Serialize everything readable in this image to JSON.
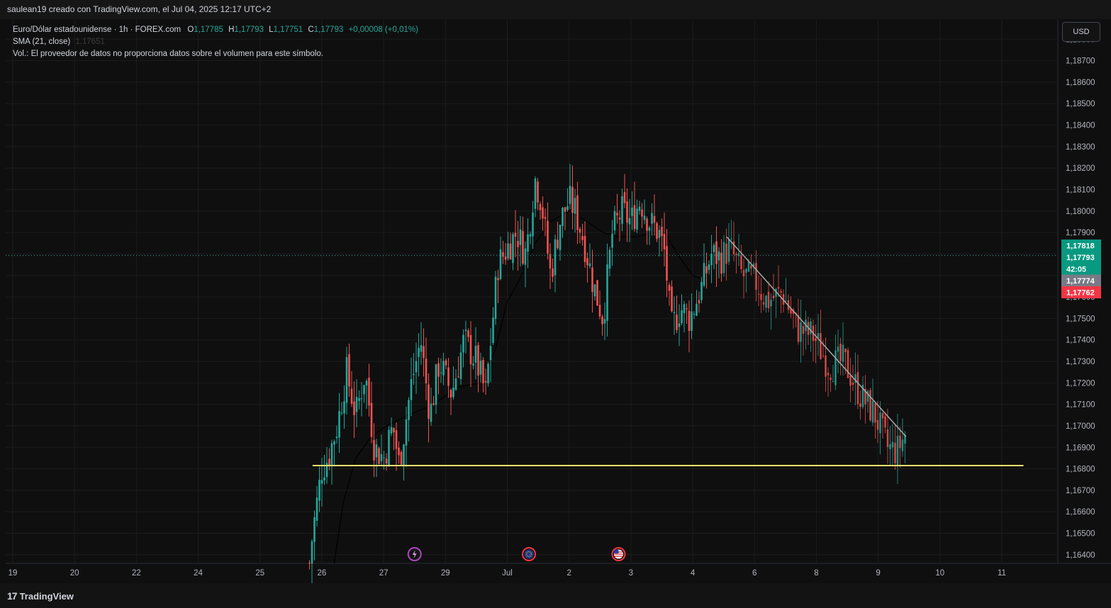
{
  "header": {
    "attribution": "saulean19 creado con TradingView.com, el Jul 04, 2025 12:17 UTC+2"
  },
  "legend": {
    "symbol": "Euro/Dólar estadounidense · 1h · FOREX.com",
    "o_label": "O",
    "o": "1,17785",
    "h_label": "H",
    "h": "1,17793",
    "l_label": "L",
    "l": "1,17751",
    "c_label": "C",
    "c": "1,17793",
    "change": "+0,00008 (+0,01%)",
    "sma_label": "SMA (21, close)",
    "sma_value": "1,17651",
    "vol_note": "Vol.: El proveedor de datos no proporciona datos sobre el volumen para este símbolo."
  },
  "currency_button": "USD",
  "footer": {
    "brand": "TradingView",
    "brand_mark": "17"
  },
  "colors": {
    "up": "#26a69a",
    "down": "#ef5350",
    "support": "#f5e26b",
    "sma": "#000000",
    "trend": "#a9a9a9"
  },
  "price_badges": [
    {
      "value": "1,17818",
      "color": "#089981"
    },
    {
      "value": "1,17793",
      "color": "#089981"
    },
    {
      "value": "42:05",
      "color": "#089981"
    },
    {
      "value": "1,17774",
      "color": "#787b86"
    },
    {
      "value": "1,17762",
      "color": "#f23645"
    }
  ],
  "event_markers": [
    {
      "icon": "lightning-icon",
      "x": 6.5
    },
    {
      "icon": "eu-flag-icon",
      "x": 8.35
    },
    {
      "icon": "us-flag-icon",
      "x": 9.8
    }
  ],
  "chart_data": {
    "type": "candlestick",
    "symbol": "EURUSD",
    "interval": "1h",
    "x_axis": {
      "range": [
        0,
        11.5
      ],
      "ticks": [
        {
          "x": 0,
          "label": "19"
        },
        {
          "x": 1,
          "label": "20"
        },
        {
          "x": 2,
          "label": "22"
        },
        {
          "x": 3,
          "label": "24"
        },
        {
          "x": 4,
          "label": "25"
        },
        {
          "x": 5,
          "label": "26"
        },
        {
          "x": 6,
          "label": "27"
        },
        {
          "x": 7,
          "label": "29"
        },
        {
          "x": 8,
          "label": "Jul"
        },
        {
          "x": 9,
          "label": "2"
        },
        {
          "x": 10,
          "label": "3"
        },
        {
          "x": 11,
          "label": "4"
        },
        {
          "x": 12,
          "label": "6"
        },
        {
          "x": 13,
          "label": "8"
        },
        {
          "x": 14,
          "label": "9"
        },
        {
          "x": 15,
          "label": "10"
        },
        {
          "x": 16,
          "label": "11"
        }
      ]
    },
    "y_axis": {
      "range": [
        1.1636,
        1.1889
      ],
      "ticks": [
        "1,16400",
        "1,16500",
        "1,16600",
        "1,16700",
        "1,16800",
        "1,16900",
        "1,17000",
        "1,17100",
        "1,17200",
        "1,17300",
        "1,17400",
        "1,17500",
        "1,17600",
        "1,17700",
        "1,17800",
        "1,17900",
        "1,18000",
        "1,18100",
        "1,18200",
        "1,18300",
        "1,18400",
        "1,18500",
        "1,18600",
        "1,18700",
        "1,18800"
      ]
    },
    "grid": true,
    "current_price": 1.17793,
    "support_line": {
      "price": 1.16815,
      "x_start": 4.85,
      "x_end": 16.35
    },
    "trend_line": {
      "x1": 11.55,
      "y1": 1.1788,
      "x2": 14.45,
      "y2": 1.1695
    },
    "anchors": [
      [
        4.8,
        1.1636
      ],
      [
        4.85,
        1.165
      ],
      [
        4.9,
        1.166
      ],
      [
        5.0,
        1.168
      ],
      [
        5.1,
        1.1685
      ],
      [
        5.25,
        1.17
      ],
      [
        5.4,
        1.1725
      ],
      [
        5.55,
        1.1705
      ],
      [
        5.7,
        1.1725
      ],
      [
        5.85,
        1.169
      ],
      [
        6.0,
        1.1685
      ],
      [
        6.15,
        1.17
      ],
      [
        6.25,
        1.1682
      ],
      [
        6.45,
        1.172
      ],
      [
        6.6,
        1.174
      ],
      [
        6.75,
        1.1705
      ],
      [
        6.9,
        1.173
      ],
      [
        7.1,
        1.1715
      ],
      [
        7.3,
        1.174
      ],
      [
        7.5,
        1.173
      ],
      [
        7.65,
        1.1715
      ],
      [
        7.75,
        1.1745
      ],
      [
        7.85,
        1.1775
      ],
      [
        8.0,
        1.1783
      ],
      [
        8.15,
        1.179
      ],
      [
        8.3,
        1.178
      ],
      [
        8.45,
        1.1815
      ],
      [
        8.55,
        1.1805
      ],
      [
        8.7,
        1.177
      ],
      [
        8.85,
        1.1795
      ],
      [
        9.0,
        1.1805
      ],
      [
        9.1,
        1.18
      ],
      [
        9.25,
        1.1785
      ],
      [
        9.4,
        1.1765
      ],
      [
        9.55,
        1.175
      ],
      [
        9.7,
        1.179
      ],
      [
        9.85,
        1.18
      ],
      [
        10.0,
        1.1795
      ],
      [
        10.15,
        1.1805
      ],
      [
        10.3,
        1.1795
      ],
      [
        10.45,
        1.179
      ],
      [
        10.55,
        1.178
      ],
      [
        10.65,
        1.1745
      ],
      [
        10.8,
        1.1755
      ],
      [
        10.95,
        1.175
      ],
      [
        11.15,
        1.1765
      ],
      [
        11.3,
        1.178
      ],
      [
        11.45,
        1.1778
      ],
      [
        11.6,
        1.1783
      ],
      [
        11.8,
        1.177
      ],
      [
        12.0,
        1.1768
      ],
      [
        12.2,
        1.1758
      ],
      [
        12.45,
        1.1762
      ],
      [
        12.7,
        1.1745
      ],
      [
        12.95,
        1.1742
      ],
      [
        13.2,
        1.1728
      ],
      [
        13.45,
        1.173
      ],
      [
        13.7,
        1.1715
      ],
      [
        13.95,
        1.1705
      ],
      [
        14.15,
        1.169
      ],
      [
        14.3,
        1.1688
      ],
      [
        14.45,
        1.1697
      ]
    ],
    "sma": [
      [
        5.2,
        1.1636
      ],
      [
        5.35,
        1.1665
      ],
      [
        5.55,
        1.1685
      ],
      [
        5.8,
        1.1695
      ],
      [
        6.05,
        1.17
      ],
      [
        6.4,
        1.1705
      ],
      [
        6.8,
        1.171
      ],
      [
        7.2,
        1.1718
      ],
      [
        7.55,
        1.172
      ],
      [
        7.8,
        1.1735
      ],
      [
        8.0,
        1.1758
      ],
      [
        8.2,
        1.1768
      ],
      [
        8.45,
        1.1785
      ],
      [
        8.7,
        1.1795
      ],
      [
        9.0,
        1.18
      ],
      [
        9.3,
        1.1795
      ],
      [
        9.55,
        1.179
      ],
      [
        9.8,
        1.1788
      ],
      [
        10.1,
        1.1788
      ],
      [
        10.35,
        1.179
      ],
      [
        10.55,
        1.179
      ],
      [
        10.75,
        1.178
      ],
      [
        11.0,
        1.177
      ],
      [
        11.2,
        1.1768
      ],
      [
        11.35,
        1.1778
      ],
      [
        11.5,
        1.1777
      ]
    ]
  }
}
